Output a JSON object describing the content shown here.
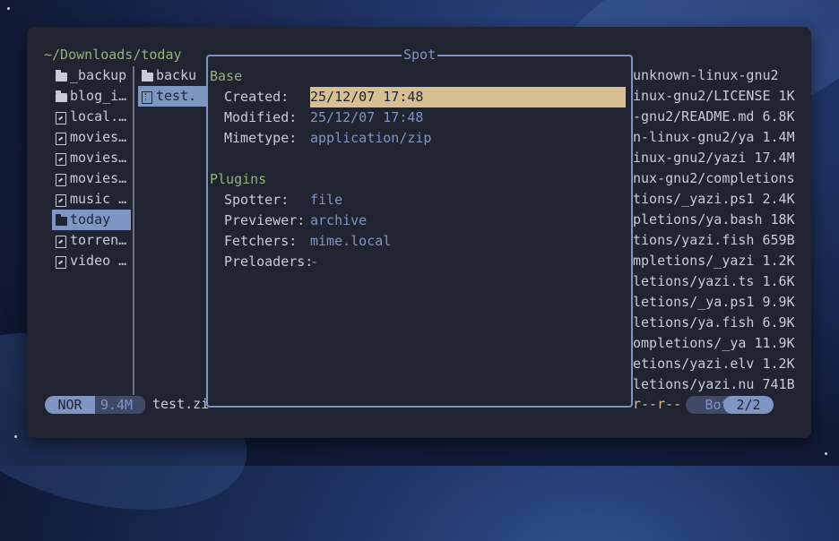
{
  "header": {
    "path": "~/Downloads/today"
  },
  "parent_list": [
    {
      "name": "_backup",
      "icon": "folder-icon",
      "selected": false
    },
    {
      "name": "blog_i…",
      "icon": "folder-icon",
      "selected": false
    },
    {
      "name": "local.…",
      "icon": "file-icon",
      "selected": false
    },
    {
      "name": "movies…",
      "icon": "file-icon",
      "selected": false
    },
    {
      "name": "movies…",
      "icon": "file-icon",
      "selected": false
    },
    {
      "name": "movies…",
      "icon": "file-icon",
      "selected": false
    },
    {
      "name": "music …",
      "icon": "file-icon",
      "selected": false
    },
    {
      "name": "today",
      "icon": "folder-icon",
      "selected": true
    },
    {
      "name": "torren…",
      "icon": "file-icon",
      "selected": false
    },
    {
      "name": "video …",
      "icon": "file-icon",
      "selected": false
    }
  ],
  "current_list": [
    {
      "name": "backu",
      "icon": "folder-icon",
      "selected": false
    },
    {
      "name": "test.",
      "icon": "zip-icon",
      "selected": true
    }
  ],
  "preview_list": [
    "unknown-linux-gnu2",
    "inux-gnu2/LICENSE 1K",
    "-gnu2/README.md 6.8K",
    "n-linux-gnu2/ya 1.4M",
    "inux-gnu2/yazi 17.4M",
    "nux-gnu2/completions",
    "tions/_yazi.ps1 2.4K",
    "pletions/ya.bash 18K",
    "tions/yazi.fish 659B",
    "mpletions/_yazi 1.2K",
    "letions/yazi.ts 1.6K",
    "letions/_ya.ps1 9.9K",
    "letions/ya.fish 6.9K",
    "ompletions/_ya 11.9K",
    "etions/yazi.elv 1.2K",
    "letions/yazi.nu 741B"
  ],
  "spot": {
    "title": "Spot",
    "base": {
      "heading": "Base",
      "created_label": "Created:",
      "created_value": "25/12/07 17:48",
      "modified_label": "Modified:",
      "modified_value": "25/12/07 17:48",
      "mimetype_label": "Mimetype:",
      "mimetype_value": "application/zip"
    },
    "plugins": {
      "heading": "Plugins",
      "spotter_label": "Spotter:",
      "spotter_value": "file",
      "previewer_label": "Previewer:",
      "previewer_value": "archive",
      "fetchers_label": "Fetchers:",
      "fetchers_value": "mime.local",
      "preloaders_label": "Preloaders:",
      "preloaders_value": "-"
    }
  },
  "status": {
    "mode": "NOR",
    "size": "9.4M",
    "filename": "test.zi",
    "permissions": "r--r--",
    "scroll": "Bot",
    "position": "2/2"
  },
  "colors": {
    "accent": "#7f95c4",
    "green": "#8fb57a",
    "highlight": "#d8bf92",
    "background": "#1f2430"
  }
}
